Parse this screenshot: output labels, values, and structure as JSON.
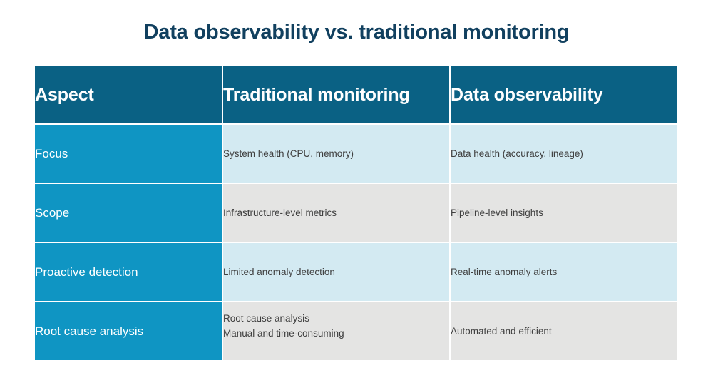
{
  "slide": {
    "title": "Data observability vs. traditional monitoring"
  },
  "table": {
    "columns": [
      {
        "key": "aspect",
        "label": "Aspect"
      },
      {
        "key": "traditional",
        "label": "Traditional monitoring"
      },
      {
        "key": "observability",
        "label": "Data observability"
      }
    ],
    "rows": [
      {
        "aspect": "Focus",
        "traditional": "System health (CPU, memory)",
        "traditional_line2": "",
        "observability": "Data health (accuracy, lineage)",
        "tint": "blue"
      },
      {
        "aspect": "Scope",
        "traditional": "Infrastructure-level metrics",
        "traditional_line2": "",
        "observability": "Pipeline-level insights",
        "tint": "gray"
      },
      {
        "aspect": "Proactive detection",
        "traditional": "Limited anomaly detection",
        "traditional_line2": "",
        "observability": "Real-time anomaly alerts",
        "tint": "blue"
      },
      {
        "aspect": "Root cause analysis",
        "traditional": "Root cause analysis",
        "traditional_line2": "Manual and time-consuming",
        "observability": "Automated and efficient",
        "tint": "gray"
      }
    ]
  },
  "colors": {
    "header_bg": "#0a6184",
    "aspect_bg": "#0f95c3",
    "row_tint_blue": "#d3eaf2",
    "row_tint_gray": "#e4e4e3",
    "title_text": "#11405f",
    "body_text": "#3f3f3f"
  }
}
